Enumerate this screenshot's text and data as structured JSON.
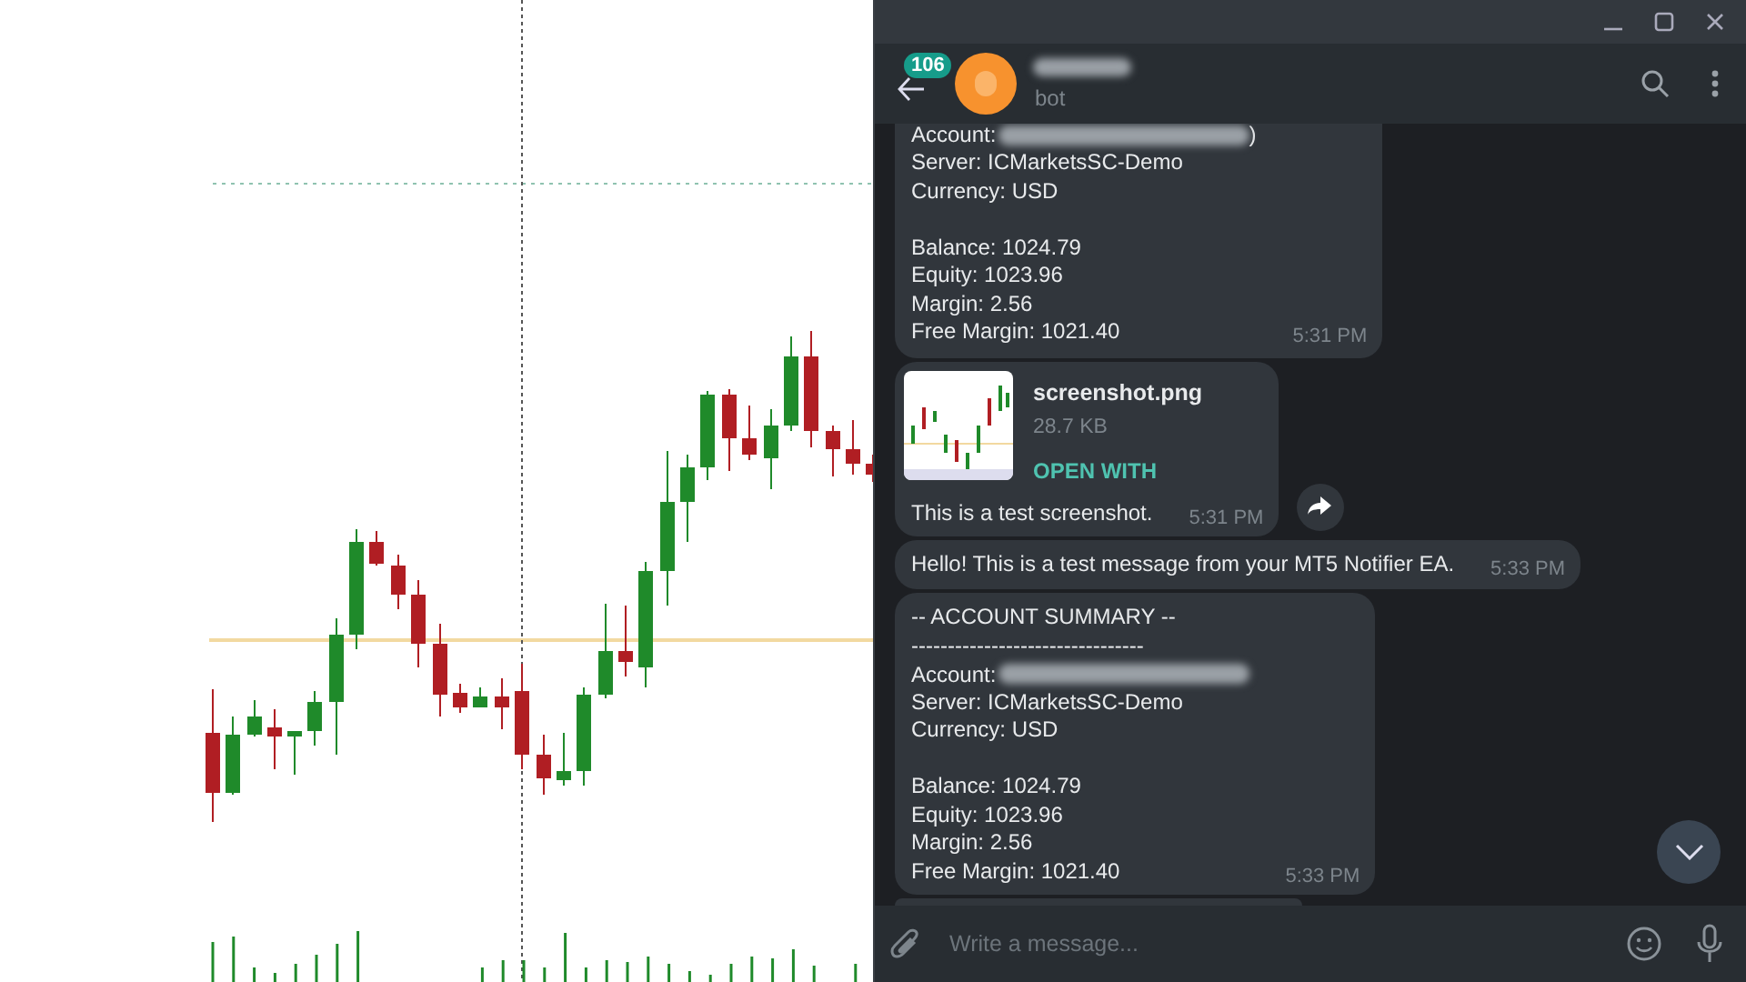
{
  "header": {
    "unread_badge": "106",
    "subtitle": "bot"
  },
  "messages": [
    {
      "kind": "text",
      "groups": [
        [
          {
            "text": "Account:",
            "redacted": true,
            "after": ")"
          },
          "Server: ICMarketsSC-Demo",
          "Currency: USD"
        ],
        [
          "Balance: 1024.79",
          "Equity: 1023.96",
          "Margin: 2.56",
          "Free Margin: 1021.40"
        ]
      ],
      "time": "5:31 PM"
    },
    {
      "kind": "file",
      "file_name": "screenshot.png",
      "file_size": "28.7 KB",
      "action": "OPEN WITH",
      "caption": "This is a test screenshot.",
      "time": "5:31 PM"
    },
    {
      "kind": "text",
      "groups": [
        [
          "Hello! This is a test message from your MT5 Notifier EA."
        ]
      ],
      "time": "5:33 PM"
    },
    {
      "kind": "text",
      "groups": [
        [
          "-- ACCOUNT SUMMARY --",
          "--------------------------------",
          {
            "text": "Account:",
            "redacted": true
          },
          "Server: ICMarketsSC-Demo",
          "Currency: USD"
        ],
        [
          "Balance: 1024.79",
          "Equity: 1023.96",
          "Margin: 2.56",
          "Free Margin: 1021.40"
        ]
      ],
      "time": "5:33 PM"
    },
    {
      "kind": "partial"
    }
  ],
  "composer": {
    "placeholder": "Write a message..."
  }
}
